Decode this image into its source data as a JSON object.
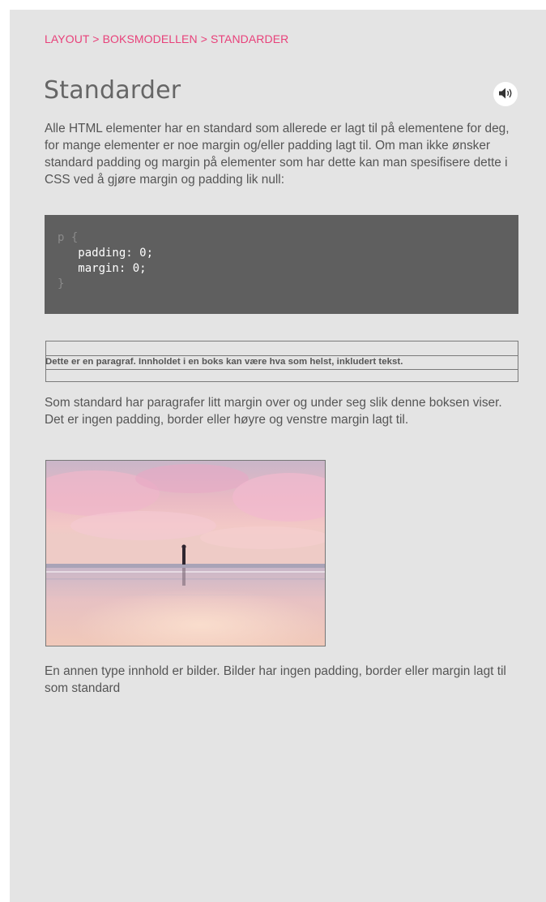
{
  "breadcrumb": "LAYOUT > BOKSMODELLEN > STANDARDER",
  "title": "Standarder",
  "intro": "Alle HTML elementer har en standard som allerede er lagt til på elementene for deg, for mange elementer er noe margin og/eller padding lagt til. Om man ikke ønsker standard padding og margin på elementer som har dette kan man spesifisere dette i CSS ved å gjøre margin og padding lik null:",
  "code": {
    "open": "p {",
    "line1": "   padding: 0;",
    "line2": "   margin: 0;",
    "close": "}"
  },
  "demo_paragraph": "Dette er en paragraf. Innholdet i en boks kan være hva som helst, inkludert tekst.",
  "after_demo": "Som standard har paragrafer litt margin over og under seg slik denne boksen viser. Det er ingen padding, border eller høyre og venstre margin lagt til.",
  "caption": "En annen type innhold er bilder. Bilder har ingen padding, border eller margin lagt til som standard",
  "icons": {
    "audio": "speaker-icon"
  },
  "colors": {
    "accent": "#e8417a",
    "panel": "#e4e4e4",
    "code_bg": "#5f5f5f"
  }
}
